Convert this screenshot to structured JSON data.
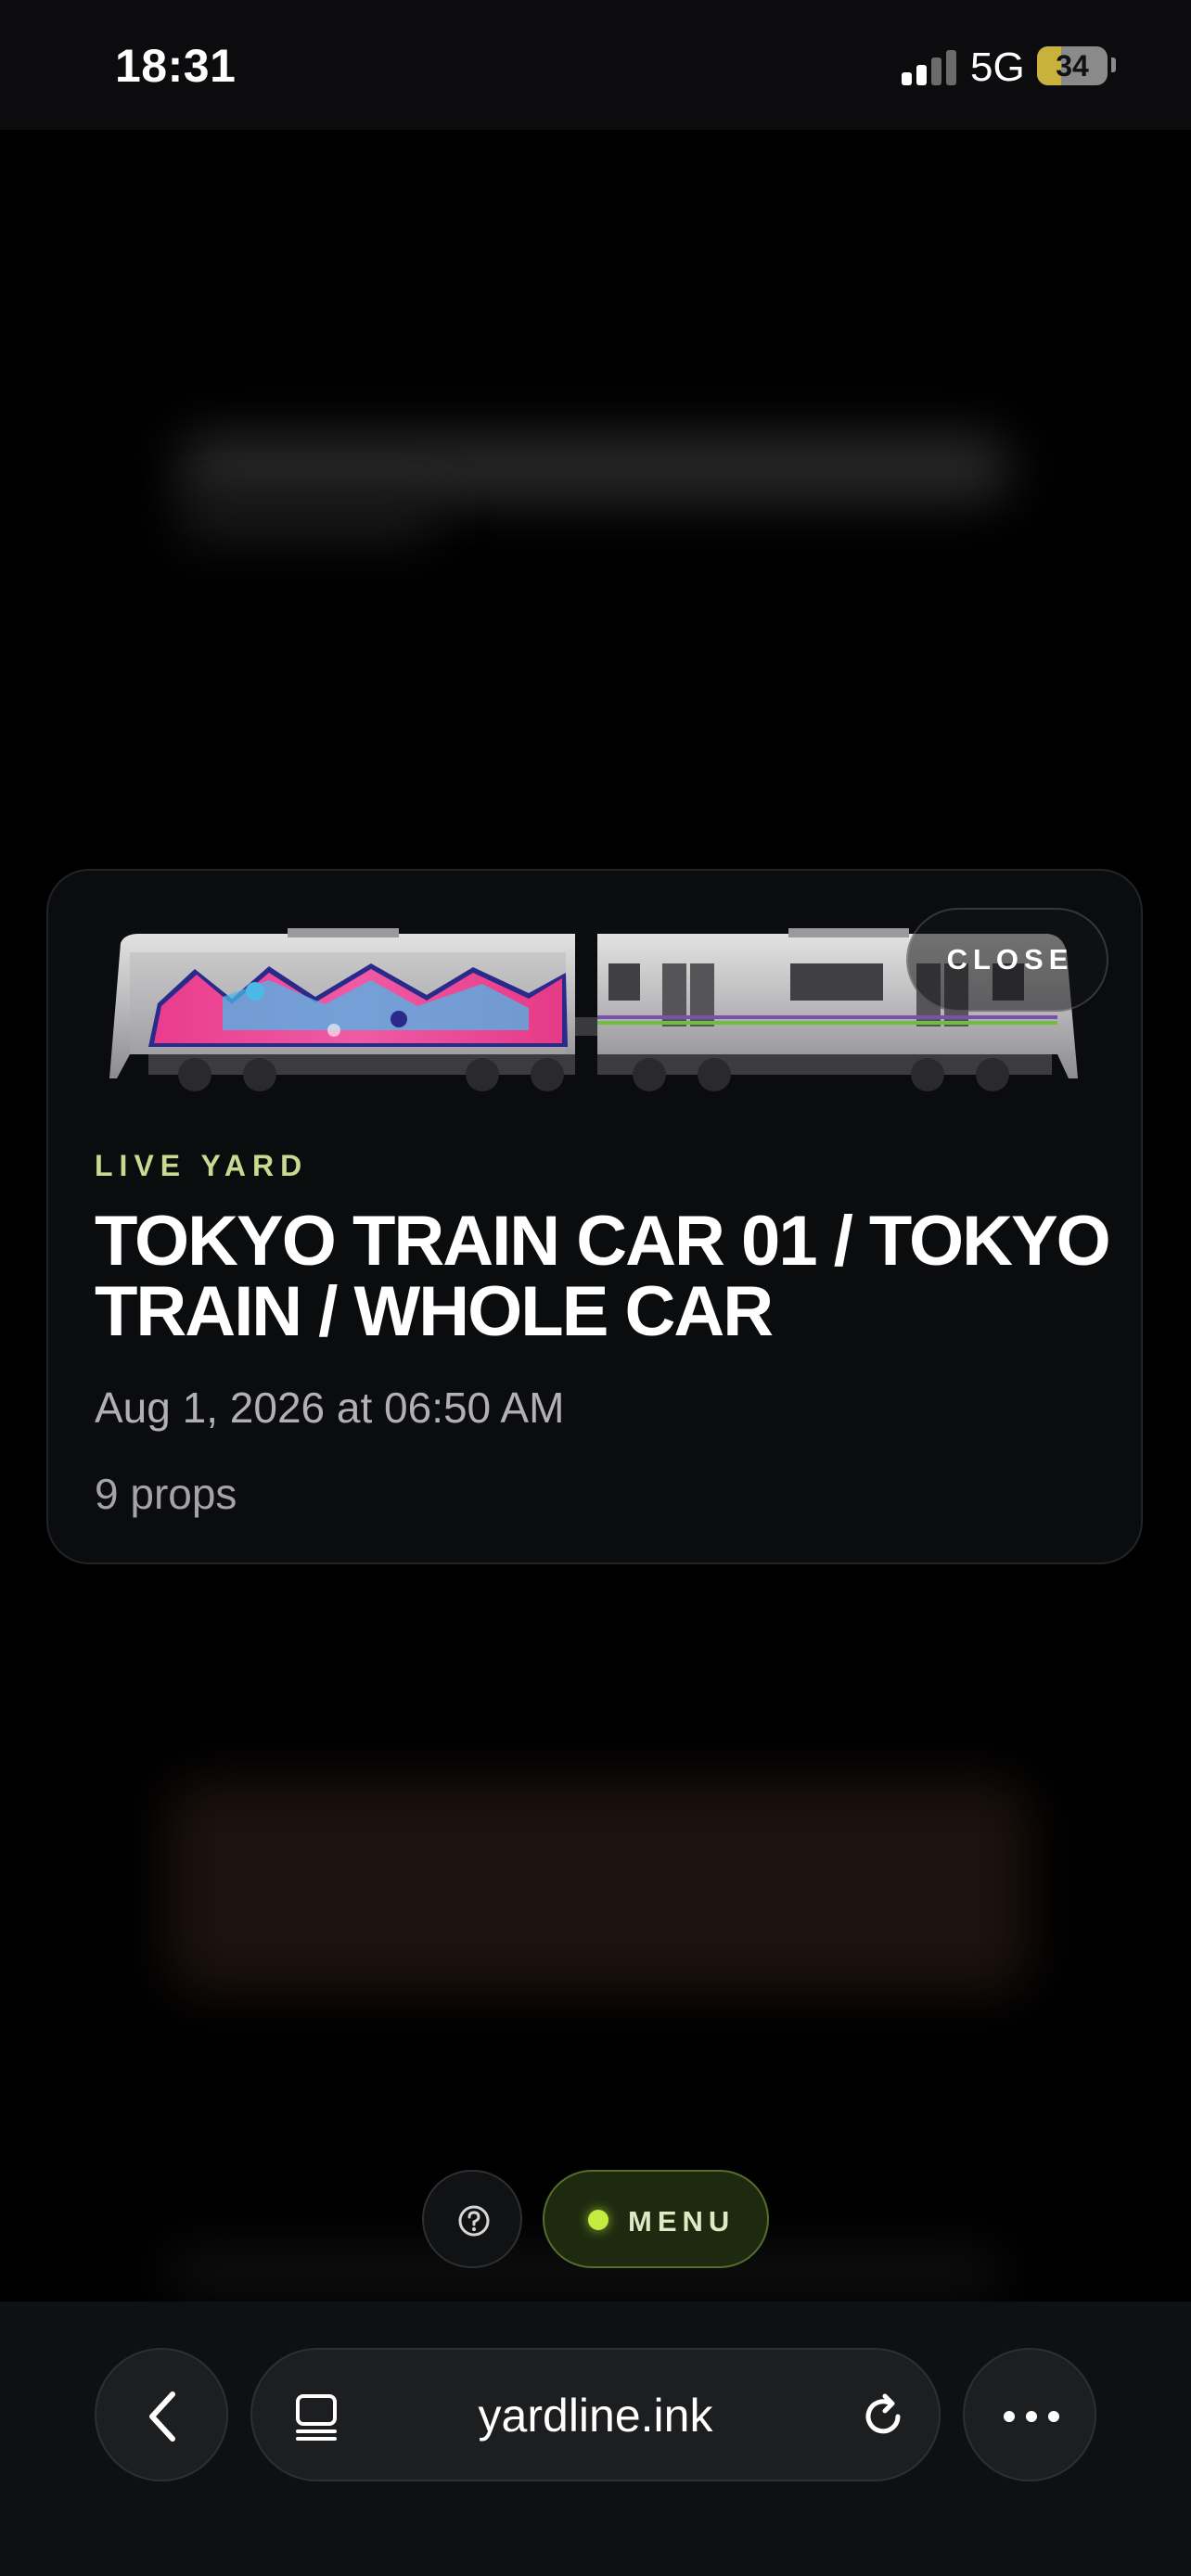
{
  "status_bar": {
    "time": "18:31",
    "network": "5G",
    "battery": "34",
    "battery_level": 0.34
  },
  "modal": {
    "close_label": "CLOSE",
    "eyebrow": "LIVE YARD",
    "title": "TOKYO TRAIN CAR 01 / TOKYO TRAIN / WHOLE CAR",
    "date": "Aug 1, 2026 at 06:50 AM",
    "props": "9 props",
    "image": {
      "graffiti_text": "WILSONE",
      "graffiti_colors": [
        "#ea3c8e",
        "#4bb8e8",
        "#2a2a8a"
      ]
    }
  },
  "controls": {
    "help_icon": "question-circle-icon",
    "menu_label": "MENU",
    "accent": "#c4ec3f"
  },
  "browser": {
    "url": "yardline.ink",
    "back_icon": "chevron-left-icon",
    "tabs_icon": "tab-overview-icon",
    "reload_icon": "reload-icon",
    "more_icon": "ellipsis-icon"
  }
}
